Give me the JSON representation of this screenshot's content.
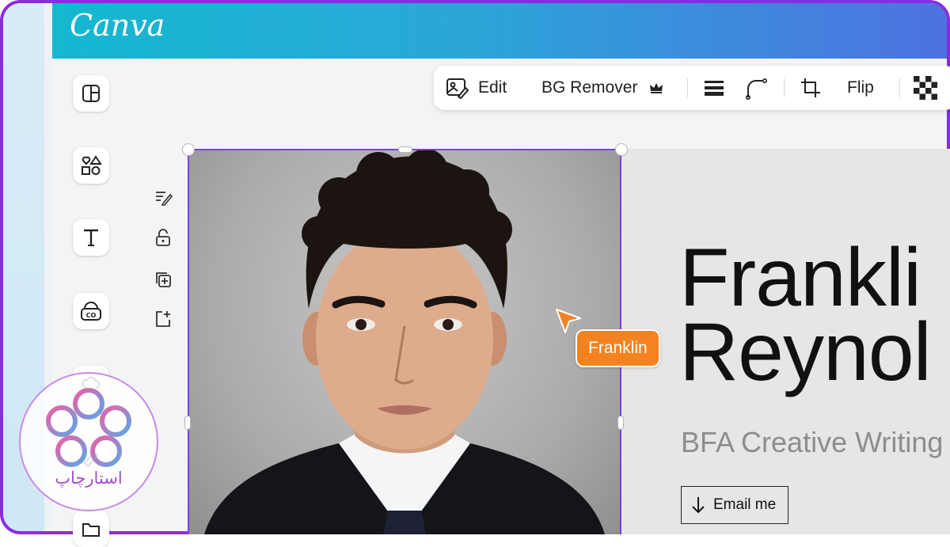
{
  "app": {
    "logo_text": "Canva"
  },
  "sidebar": {
    "items": [
      {
        "icon": "layout-icon"
      },
      {
        "icon": "elements-icon"
      },
      {
        "icon": "text-icon"
      },
      {
        "icon": "brand-icon"
      },
      {
        "icon": "uploads-icon"
      },
      {
        "icon": "draw-icon"
      },
      {
        "icon": "projects-icon"
      }
    ]
  },
  "mini_tools": [
    {
      "icon": "notes-icon"
    },
    {
      "icon": "lock-icon"
    },
    {
      "icon": "duplicate-icon"
    },
    {
      "icon": "add-page-icon"
    }
  ],
  "toolbar": {
    "edit_label": "Edit",
    "bg_remover_label": "BG Remover",
    "flip_label": "Flip"
  },
  "design": {
    "name_line1": "Frankli",
    "name_line2": "Reynol",
    "subtitle": "BFA Creative Writing",
    "email_button_label": "Email me"
  },
  "collaborator_cursor": {
    "label": "Franklin",
    "color": "#f58220"
  },
  "colors": {
    "selection": "#7b3fe4",
    "brand_gradient_start": "#14b8cf",
    "brand_gradient_end": "#4d72e0"
  },
  "watermark": {
    "text": "استارچاپ"
  }
}
